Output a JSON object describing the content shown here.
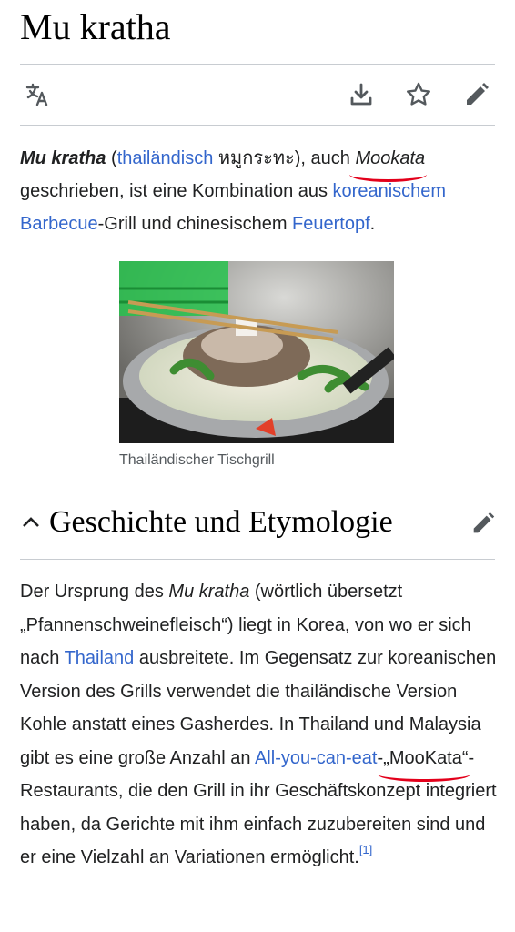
{
  "page": {
    "title": "Mu kratha"
  },
  "toolbar": {
    "language_icon": "translate-icon",
    "download_icon": "download-icon",
    "watch_icon": "star-icon",
    "edit_icon": "pencil-icon"
  },
  "intro": {
    "term": "Mu kratha",
    "open_paren": " (",
    "lang_link": "thailändisch",
    "thai": " หมูกระทะ",
    "after_thai": "), auch ",
    "alt_name": "Mookata",
    "mid": " geschrieben, ist eine Kombination aus ",
    "link_korean": "koreanischem Barbecue",
    "mid2": "-Grill und chinesischem ",
    "link_hotpot": "Feuertopf",
    "end": "."
  },
  "figure": {
    "caption": "Thailändischer Tischgrill"
  },
  "section": {
    "title": "Geschichte und Etymologie",
    "p_1": "Der Ursprung des ",
    "p_term": "Mu kratha",
    "p_2": " (wörtlich übersetzt „Pfannenschweinefleisch“) liegt in Korea, von wo er sich nach ",
    "p_link_thailand": "Thailand",
    "p_3": " ausbreitete. Im Gegensatz zur koreanischen Version des Grills verwendet die thailändische Version Kohle anstatt eines Gasherdes. In Thailand und Malaysia gibt es eine große Anzahl an ",
    "p_link_ayce": "All-you-can-eat",
    "p_4": "-",
    "p_mookata": "„MooKata“",
    "p_5": "-Restaurants, die den Grill in ihr Geschäftskonzept integriert haben, da Gerichte mit ihm einfach zuzubereiten sind und er eine Vielzahl an Variationen ermöglicht.",
    "ref": "[1]"
  },
  "colors": {
    "link": "#3366cc",
    "text": "#202122",
    "annotation": "#e3001b"
  }
}
